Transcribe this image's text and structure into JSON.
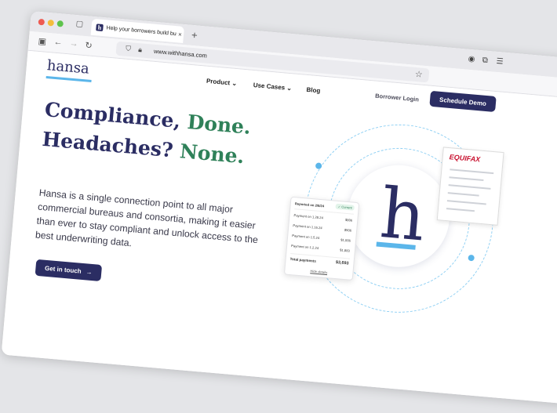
{
  "tab": {
    "title": "Help your borrowers build busi",
    "close": "×",
    "new_tab": "+"
  },
  "address": {
    "url": "www.withhansa.com"
  },
  "site": {
    "logo": "hansa",
    "nav": [
      {
        "label": "Product",
        "has_dropdown": true
      },
      {
        "label": "Use Cases",
        "has_dropdown": true
      },
      {
        "label": "Blog",
        "has_dropdown": false
      }
    ],
    "borrower_login": "Borrower Login",
    "schedule_demo": "Schedule Demo"
  },
  "hero": {
    "line1_a": "Compliance, ",
    "line1_b": "Done.",
    "line2_a": "Headaches? ",
    "line2_b": "None.",
    "body": "Hansa is a single connection point to all major commercial bureaus and consortia, making it easier than ever to stay compliant and unlock access to the best underwriting data.",
    "cta": "Get in touch",
    "cta_icon": "→"
  },
  "illustration": {
    "brand_letter": "h",
    "bureau_name": "EQUIFAX",
    "card": {
      "reported": "Reported on 2/8/24",
      "status": "Current",
      "rows": [
        {
          "label": "Payment on 1.28.24",
          "amount": "$806"
        },
        {
          "label": "Payment on 1.16.24",
          "amount": "$906"
        },
        {
          "label": "Payment on 1.5.24",
          "amount": "$1,006"
        },
        {
          "label": "Payment on 1.2.24",
          "amount": "$1,883"
        }
      ],
      "total_label": "Total payments",
      "total_amount": "$3,693",
      "hide_details": "Hide details"
    }
  },
  "colors": {
    "brand_navy": "#2b2d63",
    "brand_green": "#2f8159",
    "accent_blue": "#5bb6ea",
    "equifax_red": "#c8102e"
  }
}
